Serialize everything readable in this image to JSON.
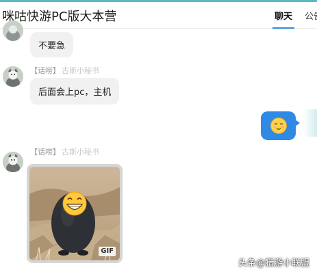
{
  "header": {
    "title": "咪咕快游PC版大本营",
    "tabs": [
      {
        "label": "聊天",
        "active": true
      },
      {
        "label": "公告",
        "active": false
      }
    ],
    "accent_color": "#2b8de0"
  },
  "messages": [
    {
      "sender": "other",
      "tag": "",
      "nick": "",
      "text": "不要急"
    },
    {
      "sender": "other",
      "tag": "【话唠】",
      "nick": "古斯小秘书",
      "text": "后面会上pc，主机"
    },
    {
      "sender": "self",
      "type": "emoji",
      "icon": "smiling-face-emoji-icon"
    },
    {
      "sender": "other",
      "tag": "【话唠】",
      "nick": "古斯小秘书",
      "type": "gif",
      "badge": "GIF",
      "icon": "grinning-emoji-mask-icon"
    }
  ],
  "watermark": "头条@猎游小联盟",
  "colors": {
    "bubble_other": "#f1f1f1",
    "bubble_self": "#2f8ae6",
    "top_line": "#5cb8c2"
  }
}
